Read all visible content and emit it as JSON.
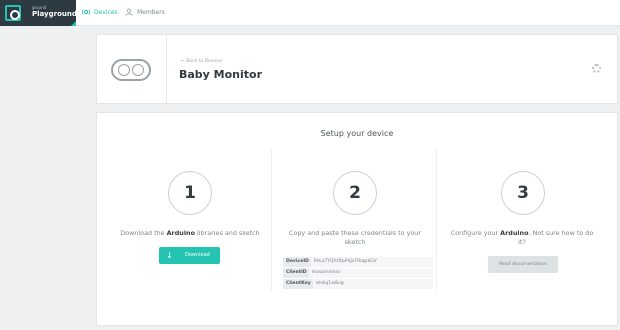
{
  "header": {
    "logo_small": "ground",
    "logo_big": "Playground",
    "nav": [
      {
        "label": "Devices",
        "icon": "devices-icon",
        "active": true
      },
      {
        "label": "Members",
        "icon": "user-icon",
        "active": false
      }
    ]
  },
  "device": {
    "back_link": "←  Back to Devices",
    "title": "Baby Monitor",
    "icon": "arduino-infinity-icon"
  },
  "setup": {
    "title": "Setup your device",
    "steps": [
      {
        "number": "1",
        "text_before": "Download the ",
        "text_bold": "Arduino",
        "text_after": " libraries and sketch"
      },
      {
        "number": "2",
        "text": "Copy and paste these credentials to your sketch"
      },
      {
        "number": "3",
        "text_before": "Configure your ",
        "text_bold": "Arduino",
        "text_after": ". Not sure how to do it?"
      }
    ],
    "download_label": "Download",
    "credentials": [
      {
        "key": "DeviceID",
        "value": "PeLz7YQhOtpPdjxITbqpkGV"
      },
      {
        "key": "ClientID",
        "value": "mosammino"
      },
      {
        "key": "ClientKey",
        "value": "atskq1w8ug"
      }
    ],
    "docs_label": "Read documentation"
  },
  "colors": {
    "accent": "#25c3b1",
    "sidebar": "#2d3a41",
    "background": "#eef0f1"
  }
}
